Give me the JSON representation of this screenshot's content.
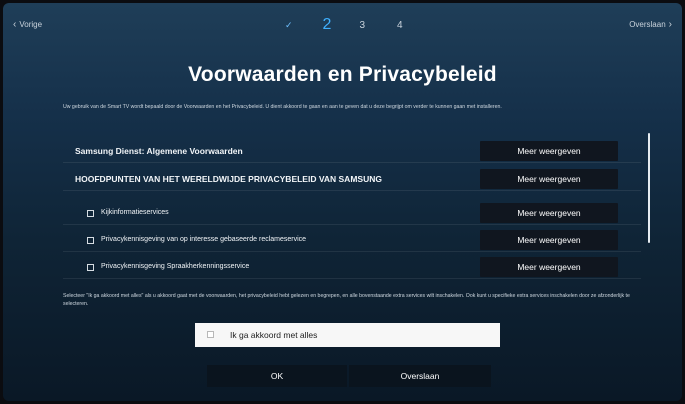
{
  "nav": {
    "back_label": "Vorige",
    "skip_label": "Overslaan",
    "steps": [
      {
        "label": "✓",
        "state": "done"
      },
      {
        "label": "2",
        "state": "active"
      },
      {
        "label": "3",
        "state": "pending"
      },
      {
        "label": "4",
        "state": "pending"
      }
    ]
  },
  "page": {
    "title": "Voorwaarden en Privacybeleid",
    "intro": "Uw gebruik van de Smart TV wordt bepaald door de Voorwaarden en het Privacybeleid. U dient akkoord te gaan en aan te geven dat u deze begrijpt om verder te kunnen gaan met installeren."
  },
  "items": [
    {
      "label": "Samsung Dienst: Algemene Voorwaarden",
      "button": "Meer weergeven",
      "has_checkbox": false
    },
    {
      "label": "HOOFDPUNTEN VAN HET WERELDWIJDE PRIVACYBELEID VAN SAMSUNG",
      "button": "Meer weergeven",
      "has_checkbox": false
    },
    {
      "label": "Kijkinformatieservices",
      "button": "Meer weergeven",
      "has_checkbox": true
    },
    {
      "label": "Privacykennisgeving van op interesse gebaseerde reclameservice",
      "button": "Meer weergeven",
      "has_checkbox": true
    },
    {
      "label": "Privacykennisgeving Spraakherkenningsservice",
      "button": "Meer weergeven",
      "has_checkbox": true
    }
  ],
  "notice": "Selecteer \"Ik ga akkoord met alles\" als u akkoord gaat met de voorwaarden, het privacybeleid hebt gelezen en begrepen, en alle bovenstaande extra services wilt inschakelen. Ook kunt u specifieke extra services inschakelen door ze afzonderlijk te selecteren.",
  "agree_all": {
    "label": "Ik ga akkoord met alles",
    "checked": false
  },
  "footer": {
    "ok_label": "OK",
    "skip_label": "Overslaan"
  },
  "colors": {
    "accent": "#3fb0ff",
    "background": "#15304a",
    "button": "#10161f"
  }
}
